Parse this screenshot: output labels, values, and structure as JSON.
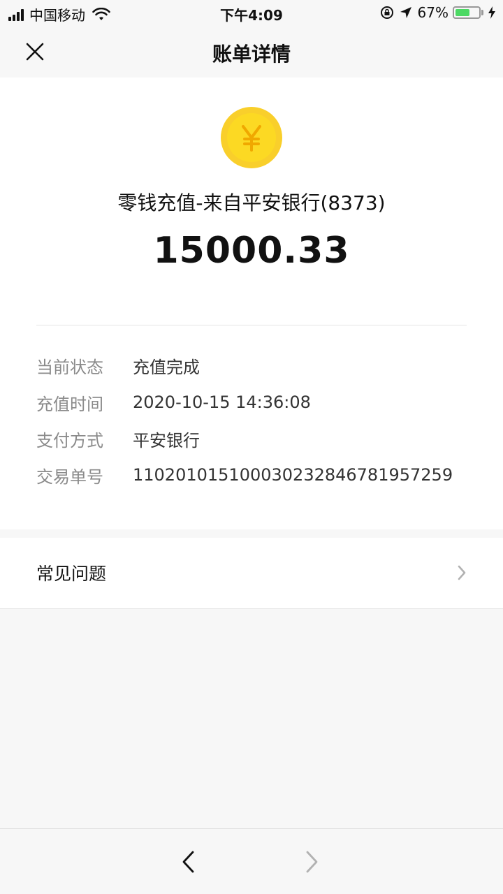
{
  "status_bar": {
    "carrier": "中国移动",
    "time": "下午4:09",
    "battery_percent": "67%",
    "battery_level": 0.67,
    "battery_color": "#4cd964"
  },
  "nav": {
    "title": "账单详情",
    "close_icon": "close-icon"
  },
  "bill": {
    "icon": "yuan-coin-icon",
    "coin_color": "#f9cf2b",
    "title": "零钱充值-来自平安银行(8373)",
    "amount": "15000.33"
  },
  "details": [
    {
      "label": "当前状态",
      "value": "充值完成"
    },
    {
      "label": "充值时间",
      "value": "2020-10-15 14:36:08"
    },
    {
      "label": "支付方式",
      "value": "平安银行"
    },
    {
      "label": "交易单号",
      "value": "110201015100030232846781957259"
    }
  ],
  "faq": {
    "label": "常见问题",
    "icon": "chevron-right-icon"
  },
  "bottom_nav": {
    "back_icon": "chevron-left-icon",
    "forward_icon": "chevron-right-icon"
  }
}
